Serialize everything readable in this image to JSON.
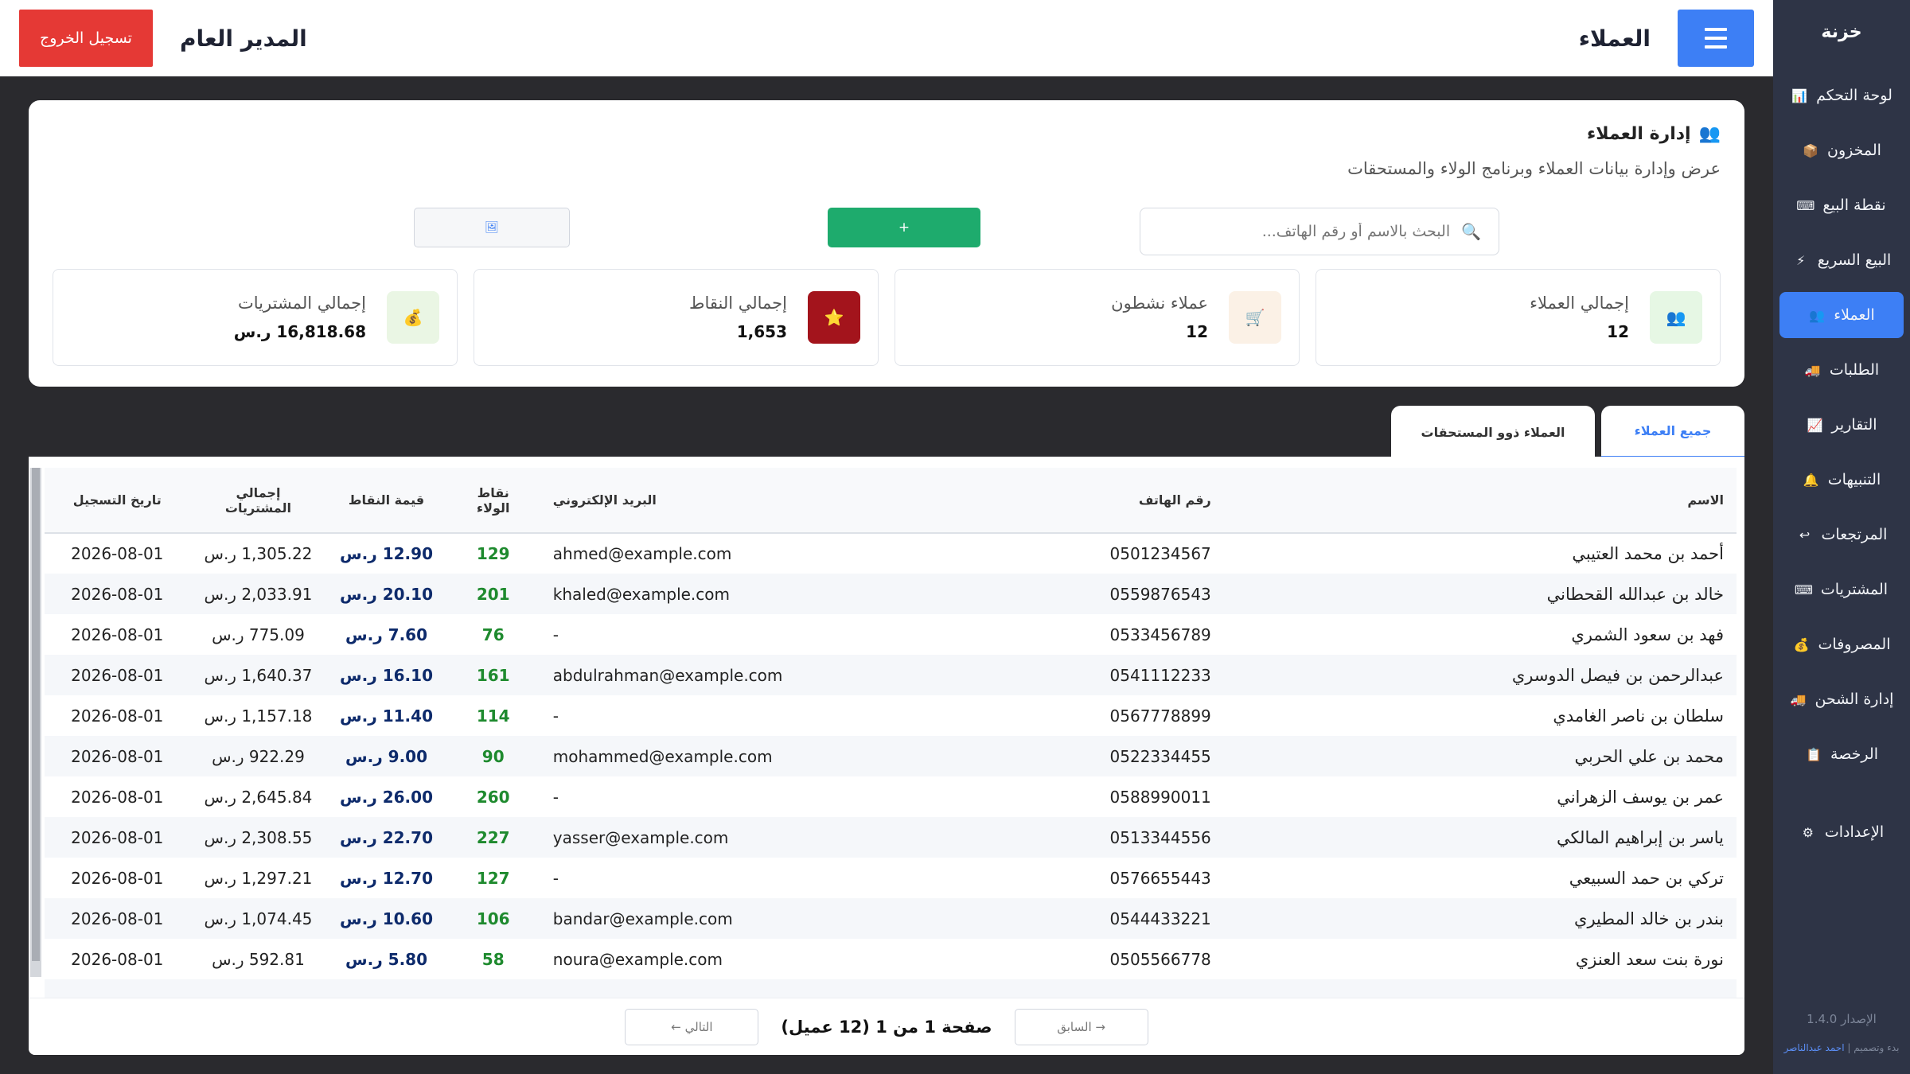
{
  "sidebar": {
    "brand": "خزنة",
    "items": [
      {
        "label": "لوحة التحكم",
        "icon": "📊"
      },
      {
        "label": "المخزون",
        "icon": "📦"
      },
      {
        "label": "نقطة البيع",
        "icon": "⌨"
      },
      {
        "label": "البيع السريع",
        "icon": "⚡"
      },
      {
        "label": "العملاء",
        "icon": "👥"
      },
      {
        "label": "الطلبات",
        "icon": "🚚"
      },
      {
        "label": "التقارير",
        "icon": "📈"
      },
      {
        "label": "التنبيهات",
        "icon": "🔔"
      },
      {
        "label": "المرتجعات",
        "icon": "↩"
      },
      {
        "label": "المشتريات",
        "icon": "⌨"
      },
      {
        "label": "المصروفات",
        "icon": "💰"
      },
      {
        "label": "إدارة الشحن",
        "icon": "🚚"
      },
      {
        "label": "الرخصة",
        "icon": "📋"
      }
    ],
    "settings": {
      "label": "الإعدادات",
      "icon": "⚙"
    },
    "version": "الإصدار 1.4.0",
    "credits_prefix": "بدء وتصميم |",
    "credits_author": "احمد عبدالناصر"
  },
  "header": {
    "title": "العملاء",
    "user": "المدير العام",
    "logout": "تسجيل الخروج"
  },
  "management": {
    "title": "إدارة العملاء",
    "title_icon": "👥",
    "subtitle": "عرض وإدارة بيانات العملاء وبرنامج الولاء والمستحقات",
    "search_placeholder": "البحث بالاسم أو رقم الهاتف...",
    "search_icon": "🔍",
    "add_label": "+",
    "export_label": "🖼"
  },
  "stats": [
    {
      "label": "إجمالي العملاء",
      "value": "12",
      "icon": "👥",
      "bg": "#e6f7e4"
    },
    {
      "label": "عملاء نشطون",
      "value": "12",
      "icon": "🛒",
      "bg": "#fbf1e6"
    },
    {
      "label": "إجمالي النقاط",
      "value": "1,653",
      "icon": "⭐",
      "bg": "#a3141c"
    },
    {
      "label": "إجمالي المشتريات",
      "value": "16,818.68 ر.س",
      "icon": "💰",
      "bg": "#eaf6e4"
    }
  ],
  "tabs": {
    "all": "جميع العملاء",
    "dues": "العملاء ذوو المستحقات"
  },
  "table": {
    "headers": [
      "الاسم",
      "رقم الهاتف",
      "البريد الإلكتروني",
      "نقاط الولاء",
      "قيمة النقاط",
      "إجمالي المشتريات",
      "تاريخ التسجيل"
    ],
    "rows": [
      [
        "أحمد بن محمد العتيبي",
        "0501234567",
        "ahmed@example.com",
        "129",
        "12.90 ر.س",
        "1,305.22 ر.س",
        "2026-08-01"
      ],
      [
        "خالد بن عبدالله القحطاني",
        "0559876543",
        "khaled@example.com",
        "201",
        "20.10 ر.س",
        "2,033.91 ر.س",
        "2026-08-01"
      ],
      [
        "فهد بن سعود الشمري",
        "0533456789",
        "-",
        "76",
        "7.60 ر.س",
        "775.09 ر.س",
        "2026-08-01"
      ],
      [
        "عبدالرحمن بن فيصل الدوسري",
        "0541112233",
        "abdulrahman@example.com",
        "161",
        "16.10 ر.س",
        "1,640.37 ر.س",
        "2026-08-01"
      ],
      [
        "سلطان بن ناصر الغامدي",
        "0567778899",
        "-",
        "114",
        "11.40 ر.س",
        "1,157.18 ر.س",
        "2026-08-01"
      ],
      [
        "محمد بن علي الحربي",
        "0522334455",
        "mohammed@example.com",
        "90",
        "9.00 ر.س",
        "922.29 ر.س",
        "2026-08-01"
      ],
      [
        "عمر بن يوسف الزهراني",
        "0588990011",
        "-",
        "260",
        "26.00 ر.س",
        "2,645.84 ر.س",
        "2026-08-01"
      ],
      [
        "ياسر بن إبراهيم المالكي",
        "0513344556",
        "yasser@example.com",
        "227",
        "22.70 ر.س",
        "2,308.55 ر.س",
        "2026-08-01"
      ],
      [
        "تركي بن حمد السبيعي",
        "0576655443",
        "-",
        "127",
        "12.70 ر.س",
        "1,297.21 ر.س",
        "2026-08-01"
      ],
      [
        "بندر بن خالد المطيري",
        "0544433221",
        "bandar@example.com",
        "106",
        "10.60 ر.س",
        "1,074.45 ر.س",
        "2026-08-01"
      ],
      [
        "نورة بنت سعد العنزي",
        "0505566778",
        "noura@example.com",
        "58",
        "5.80 ر.س",
        "592.81 ر.س",
        "2026-08-01"
      ],
      [
        "",
        "",
        "",
        "",
        "",
        "",
        ""
      ]
    ]
  },
  "pagination": {
    "next": "التالي ←",
    "prev": "→ السابق",
    "info": "صفحة 1 من 1 (12 عميل)"
  }
}
